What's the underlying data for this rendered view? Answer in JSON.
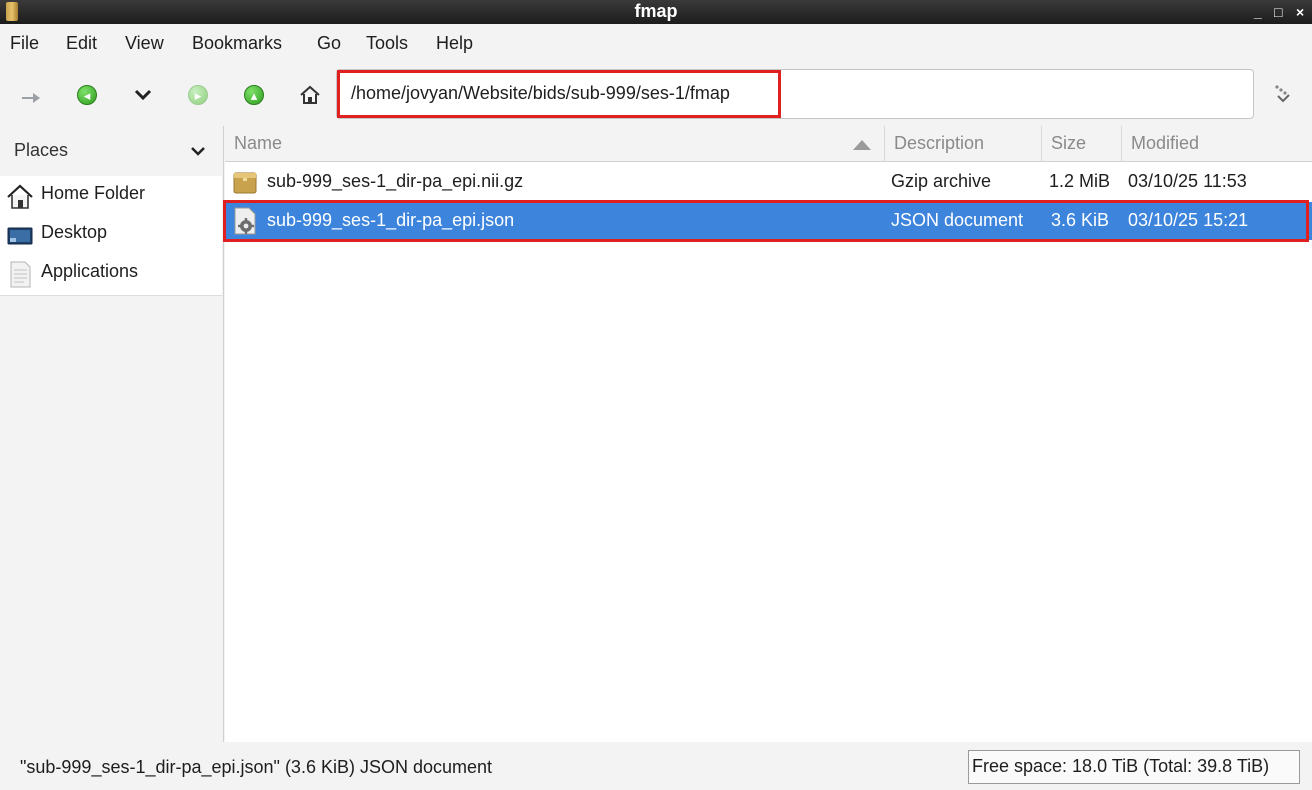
{
  "window": {
    "title": "fmap",
    "controls": [
      "_",
      "□",
      "×"
    ]
  },
  "menu": [
    "File",
    "Edit",
    "View",
    "Bookmarks",
    "Go",
    "Tools",
    "Help"
  ],
  "toolbar": {
    "path": "/home/jovyan/Website/bids/sub-999/ses-1/fmap",
    "icons": [
      "up-level-icon",
      "back-icon",
      "history-dropdown-icon",
      "forward-icon",
      "go-up-icon",
      "home-icon",
      "path-bar-toggle-icon"
    ]
  },
  "sidebar": {
    "header": "Places",
    "items": [
      {
        "label": "Home Folder",
        "icon": "home-folder-icon"
      },
      {
        "label": "Desktop",
        "icon": "desktop-icon"
      },
      {
        "label": "Applications",
        "icon": "applications-icon"
      }
    ]
  },
  "file_list": {
    "columns": [
      "Name",
      "Description",
      "Size",
      "Modified"
    ],
    "sort": "Name ascending",
    "rows": [
      {
        "name": "sub-999_ses-1_dir-pa_epi.nii.gz",
        "description": "Gzip archive",
        "size": "1.2 MiB",
        "modified": "03/10/25 11:53",
        "icon": "archive-icon",
        "selected": false
      },
      {
        "name": "sub-999_ses-1_dir-pa_epi.json",
        "description": "JSON document",
        "size": "3.6 KiB",
        "modified": "03/10/25 15:21",
        "icon": "document-gear-icon",
        "selected": true
      }
    ]
  },
  "status": {
    "message": "\"sub-999_ses-1_dir-pa_epi.json\" (3.6 KiB) JSON document",
    "free_space": "Free space: 18.0 TiB (Total: 39.8 TiB)"
  },
  "colors": {
    "selection": "#3c84dc",
    "highlight_box": "#e0201e",
    "nav_green": "#2f9d1f"
  }
}
